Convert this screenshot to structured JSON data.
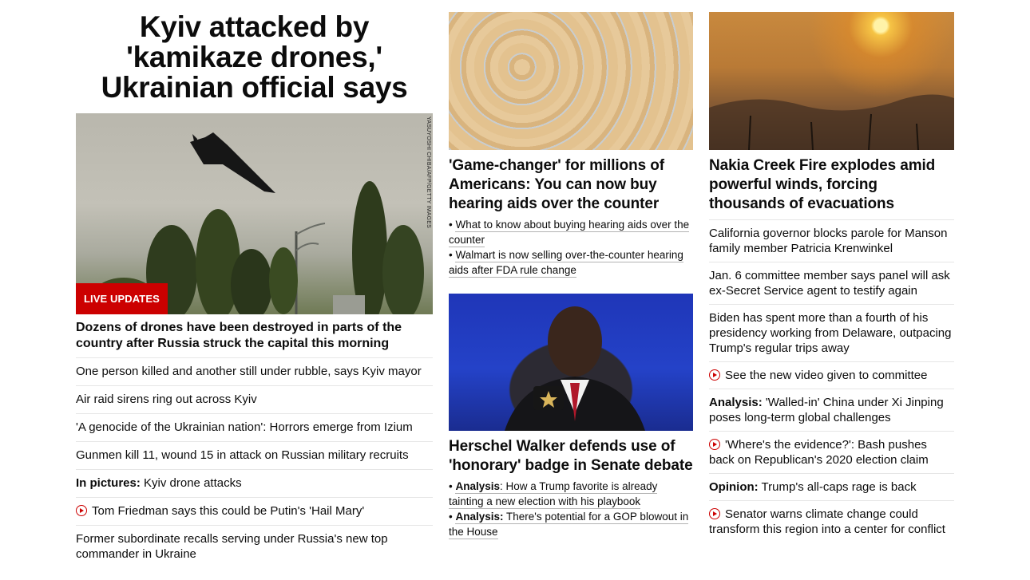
{
  "col1": {
    "banner_headline": "Kyiv attacked by 'kamikaze drones,' Ukrainian official says",
    "live_badge": "LIVE UPDATES",
    "photo_credit": "YASUYOSHI CHIBA/AFP/GETTY IMAGES",
    "lead_title": "Dozens of drones have been destroyed in parts of the country after Russia struck the capital this morning",
    "items": [
      {
        "prefix": "",
        "text": "One person killed and another still under rubble, says Kyiv mayor",
        "video": false
      },
      {
        "prefix": "",
        "text": "Air raid sirens ring out across Kyiv",
        "video": false
      },
      {
        "prefix": "",
        "text": "'A genocide of the Ukrainian nation': Horrors emerge from Izium",
        "video": false
      },
      {
        "prefix": "",
        "text": "Gunmen kill 11, wound 15 in attack on Russian military recruits",
        "video": false
      },
      {
        "prefix": "In pictures:",
        "text": " Kyiv drone attacks",
        "video": false
      },
      {
        "prefix": "",
        "text": "Tom Friedman says this could be Putin's 'Hail Mary'",
        "video": true
      },
      {
        "prefix": "",
        "text": "Former subordinate recalls serving under Russia's new top commander in Ukraine",
        "video": false
      }
    ]
  },
  "col2": {
    "story1": {
      "headline": "'Game-changer' for millions of Americans: You can now buy hearing aids over the counter",
      "links": [
        {
          "bullet": "• ",
          "prefix": "",
          "text": "What to know about buying hearing aids over the counter"
        },
        {
          "bullet": "• ",
          "prefix": "",
          "text": "Walmart is now selling over-the-counter hearing aids after FDA rule change"
        }
      ]
    },
    "story2": {
      "headline": "Herschel Walker defends use of 'honorary' badge in Senate debate",
      "links": [
        {
          "bullet": "• ",
          "prefix": "Analysis",
          "text": ": How a Trump favorite is already tainting a new election with his playbook"
        },
        {
          "bullet": "• ",
          "prefix": "Analysis:",
          "text": " There's potential for a GOP blowout in the House"
        }
      ]
    }
  },
  "col3": {
    "headline": "Nakia Creek Fire explodes amid powerful winds, forcing thousands of evacuations",
    "items": [
      {
        "prefix": "",
        "text": "California governor blocks parole for Manson family member Patricia Krenwinkel",
        "video": false
      },
      {
        "prefix": "",
        "text": "Jan. 6 committee member says panel will ask ex-Secret Service agent to testify again",
        "video": false
      },
      {
        "prefix": "",
        "text": "Biden has spent more than a fourth of his presidency working from Delaware, outpacing Trump's regular trips away",
        "video": false
      },
      {
        "prefix": "",
        "text": "See the new video given to committee",
        "video": true
      },
      {
        "prefix": "Analysis:",
        "text": " 'Walled-in' China under Xi Jinping poses long-term global challenges",
        "video": false
      },
      {
        "prefix": "",
        "text": "'Where's the evidence?': Bash pushes back on Republican's 2020 election claim",
        "video": true
      },
      {
        "prefix": "Opinion:",
        "text": " Trump's all-caps rage is back",
        "video": false
      },
      {
        "prefix": "",
        "text": "Senator warns climate change could transform this region into a center for conflict",
        "video": true
      }
    ]
  },
  "colors": {
    "accent": "#cc0000",
    "divider": "#e6e6e6",
    "text": "#0c0c0c"
  }
}
